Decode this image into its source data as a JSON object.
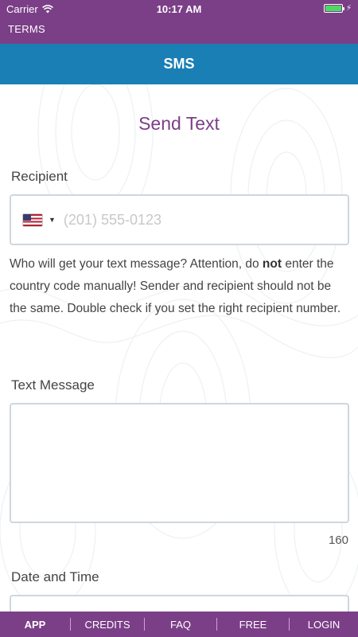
{
  "status_bar": {
    "carrier": "Carrier",
    "time": "10:17 AM",
    "battery_color": "#4cd964"
  },
  "terms": {
    "label": "TERMS"
  },
  "header": {
    "title": "SMS"
  },
  "form": {
    "title": "Send Text",
    "recipient_label": "Recipient",
    "country_flag": "flag-us-icon",
    "phone_placeholder": "(201) 555-0123",
    "phone_value": "",
    "help_text_before": "Who will get your text message? Attention, do ",
    "help_text_bold": "not",
    "help_text_after": " enter the country code manually! Sender and recipient should not be the same. Double check if you set the right recipient number.",
    "message_label": "Text Message",
    "message_value": "",
    "char_count": "160",
    "date_label": "Date and Time"
  },
  "nav": {
    "items": [
      {
        "label": "APP",
        "active": true
      },
      {
        "label": "CREDITS",
        "active": false
      },
      {
        "label": "FAQ",
        "active": false
      },
      {
        "label": "FREE",
        "active": false
      },
      {
        "label": "LOGIN",
        "active": false
      }
    ]
  },
  "colors": {
    "purple": "#7b3f87",
    "blue": "#1a7fb5",
    "border": "#cfd6de"
  }
}
